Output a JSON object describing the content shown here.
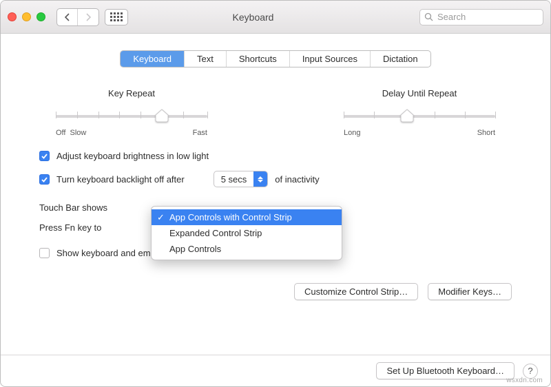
{
  "colors": {
    "accent": "#3a82f1"
  },
  "toolbar": {
    "title": "Keyboard",
    "search_placeholder": "Search"
  },
  "tabs": [
    {
      "label": "Keyboard",
      "selected": true
    },
    {
      "label": "Text"
    },
    {
      "label": "Shortcuts"
    },
    {
      "label": "Input Sources"
    },
    {
      "label": "Dictation"
    }
  ],
  "sliders": {
    "key_repeat": {
      "title": "Key Repeat",
      "min_label_a": "Off",
      "min_label_b": "Slow",
      "max_label": "Fast",
      "position_pct": 70
    },
    "delay_until_repeat": {
      "title": "Delay Until Repeat",
      "min_label": "Long",
      "max_label": "Short",
      "position_pct": 42
    }
  },
  "checks": {
    "auto_brightness": {
      "label": "Adjust keyboard brightness in low light",
      "checked": true
    },
    "backlight_off": {
      "label_pre": "Turn keyboard backlight off after",
      "value": "5 secs",
      "label_post": "of inactivity",
      "checked": true
    },
    "touch_bar_shows": {
      "label": "Touch Bar shows"
    },
    "fn_key": {
      "label": "Press Fn key to"
    },
    "show_viewers": {
      "label": "Show keyboard and emoji viewers in menu bar",
      "checked": false
    }
  },
  "touch_bar_menu": {
    "items": [
      {
        "label": "App Controls with Control Strip",
        "selected": true
      },
      {
        "label": "Expanded Control Strip"
      },
      {
        "label": "App Controls"
      }
    ]
  },
  "buttons": {
    "customize": "Customize Control Strip…",
    "modifier": "Modifier Keys…",
    "bluetooth": "Set Up Bluetooth Keyboard…"
  },
  "watermark": "wsxdn.com"
}
